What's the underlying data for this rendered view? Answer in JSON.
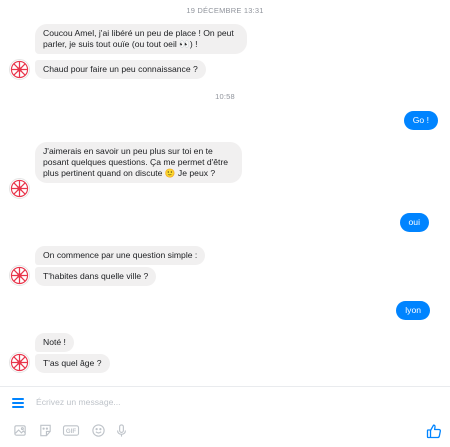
{
  "conversation": {
    "timestamp_1": "19 DÉCEMBRE 13:31",
    "timestamp_2": "10:58",
    "messages": {
      "bot_1a": "Coucou Amel, j'ai libéré un peu de place ! On peut parler, je suis tout ouïe (ou tout oeil 👀) !",
      "bot_1b": "Chaud pour faire un peu connaissance ?",
      "user_1": "Go !",
      "bot_2": "J'aimerais en savoir un peu plus sur toi en te posant quelques questions. Ça me permet d'être plus pertinent quand on discute 🙂 Je peux ?",
      "user_2": "oui",
      "bot_3a": "On commence par une question simple :",
      "bot_3b": "T'habites dans quelle ville ?",
      "user_3": "lyon",
      "bot_4a": "Noté !",
      "bot_4b": "T'as quel âge ?"
    }
  },
  "composer": {
    "placeholder": "Écrivez un message...",
    "gif_label": "GIF"
  },
  "colors": {
    "accent": "#0084ff",
    "bot_bubble": "#f1f0f0",
    "avatar_stripes": "#e8344a"
  },
  "icons": [
    "menu-icon",
    "bot-avatar-icon",
    "image-icon",
    "sticker-icon",
    "gif-icon",
    "emoji-icon",
    "microphone-icon",
    "thumbs-up-icon"
  ]
}
